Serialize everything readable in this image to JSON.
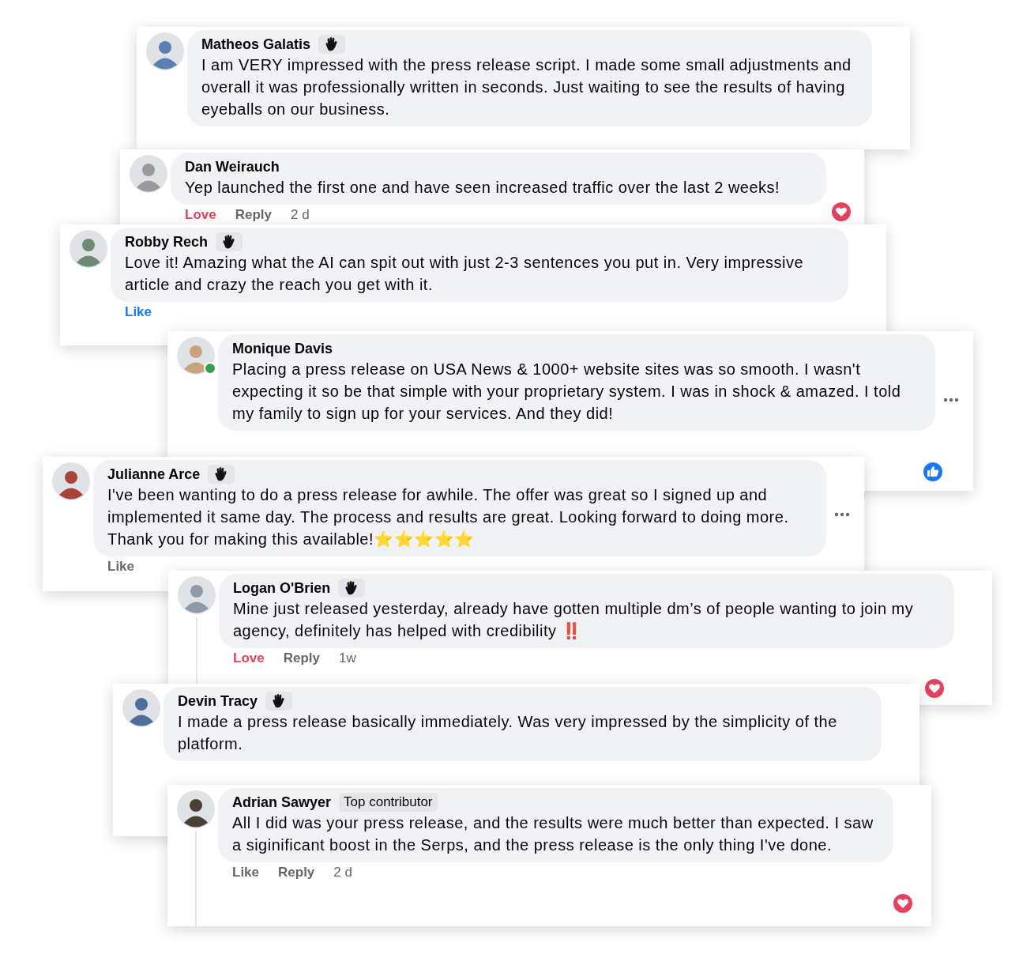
{
  "comments": [
    {
      "name": "Matheos Galatis",
      "hand_badge": true,
      "online": false,
      "more_menu": false,
      "thread": false,
      "text": "I am VERY impressed with the press release script. I made some small adjustments and overall it was professionally written in seconds. Just waiting to see the results of having eyeballs on our business."
    },
    {
      "name": "Dan Weirauch",
      "hand_badge": false,
      "online": false,
      "more_menu": false,
      "thread": false,
      "text": "Yep launched the first one and have seen increased traffic over the last 2 weeks!",
      "actions": [
        {
          "kind": "reaction",
          "label": "Love",
          "color": "#e4405f"
        },
        {
          "kind": "reply",
          "label": "Reply"
        },
        {
          "kind": "time",
          "label": "2 d"
        }
      ],
      "reaction": {
        "kind": "heart"
      }
    },
    {
      "name": "Robby Rech",
      "hand_badge": true,
      "online": false,
      "more_menu": false,
      "thread": false,
      "text": "Love it! Amazing what the AI can spit out with just 2-3 sentences you put in. Very impressive article and crazy the reach you get with it.",
      "actions": [
        {
          "kind": "reaction",
          "label": "Like",
          "color": "#1877f2"
        }
      ]
    },
    {
      "name": "Monique Davis",
      "hand_badge": false,
      "online": true,
      "more_menu": true,
      "thread": false,
      "text": "Placing a press release on USA News & 1000+ website sites was so smooth. I wasn't expecting it so be that simple with your proprietary system. I was in shock & amazed. I told my family to sign up for your services. And they did!",
      "reaction": {
        "kind": "like"
      }
    },
    {
      "name": "Julianne Arce",
      "hand_badge": true,
      "online": false,
      "more_menu": true,
      "thread": false,
      "text": "I've been wanting to do a press release for awhile. The offer was great so I signed up and implemented it same day. The process and results are great. Looking forward to doing more. Thank you for making this available!⭐⭐⭐⭐⭐",
      "actions": [
        {
          "kind": "reaction",
          "label": "Like",
          "color": "#65676b"
        }
      ]
    },
    {
      "name": "Logan O'Brien",
      "hand_badge": true,
      "online": false,
      "more_menu": false,
      "thread": true,
      "text": "Mine just released yesterday, already have gotten multiple dm’s of people wanting to join my agency, definitely has helped with credibility ‼️",
      "actions": [
        {
          "kind": "reaction",
          "label": "Love",
          "color": "#e4405f"
        },
        {
          "kind": "reply",
          "label": "Reply"
        },
        {
          "kind": "time",
          "label": "1w"
        }
      ],
      "reaction": {
        "kind": "heart"
      }
    },
    {
      "name": "Devin Tracy",
      "hand_badge": true,
      "online": false,
      "more_menu": false,
      "thread": false,
      "text": "I made a press release basically immediately. Was very impressed by the simplicity of the platform."
    },
    {
      "name": "Adrian Sawyer",
      "hand_badge": false,
      "online": false,
      "more_menu": false,
      "thread": true,
      "badge": "Top contributor",
      "text": "All I did was your press release, and the results were much better than expected. I saw a siginificant boost in the Serps, and the press release is the only thing I've done.",
      "actions": [
        {
          "kind": "reaction",
          "label": "Like",
          "color": "#65676b"
        },
        {
          "kind": "reply",
          "label": "Reply"
        },
        {
          "kind": "time",
          "label": "2 d"
        }
      ],
      "reaction": {
        "kind": "heart"
      }
    }
  ]
}
